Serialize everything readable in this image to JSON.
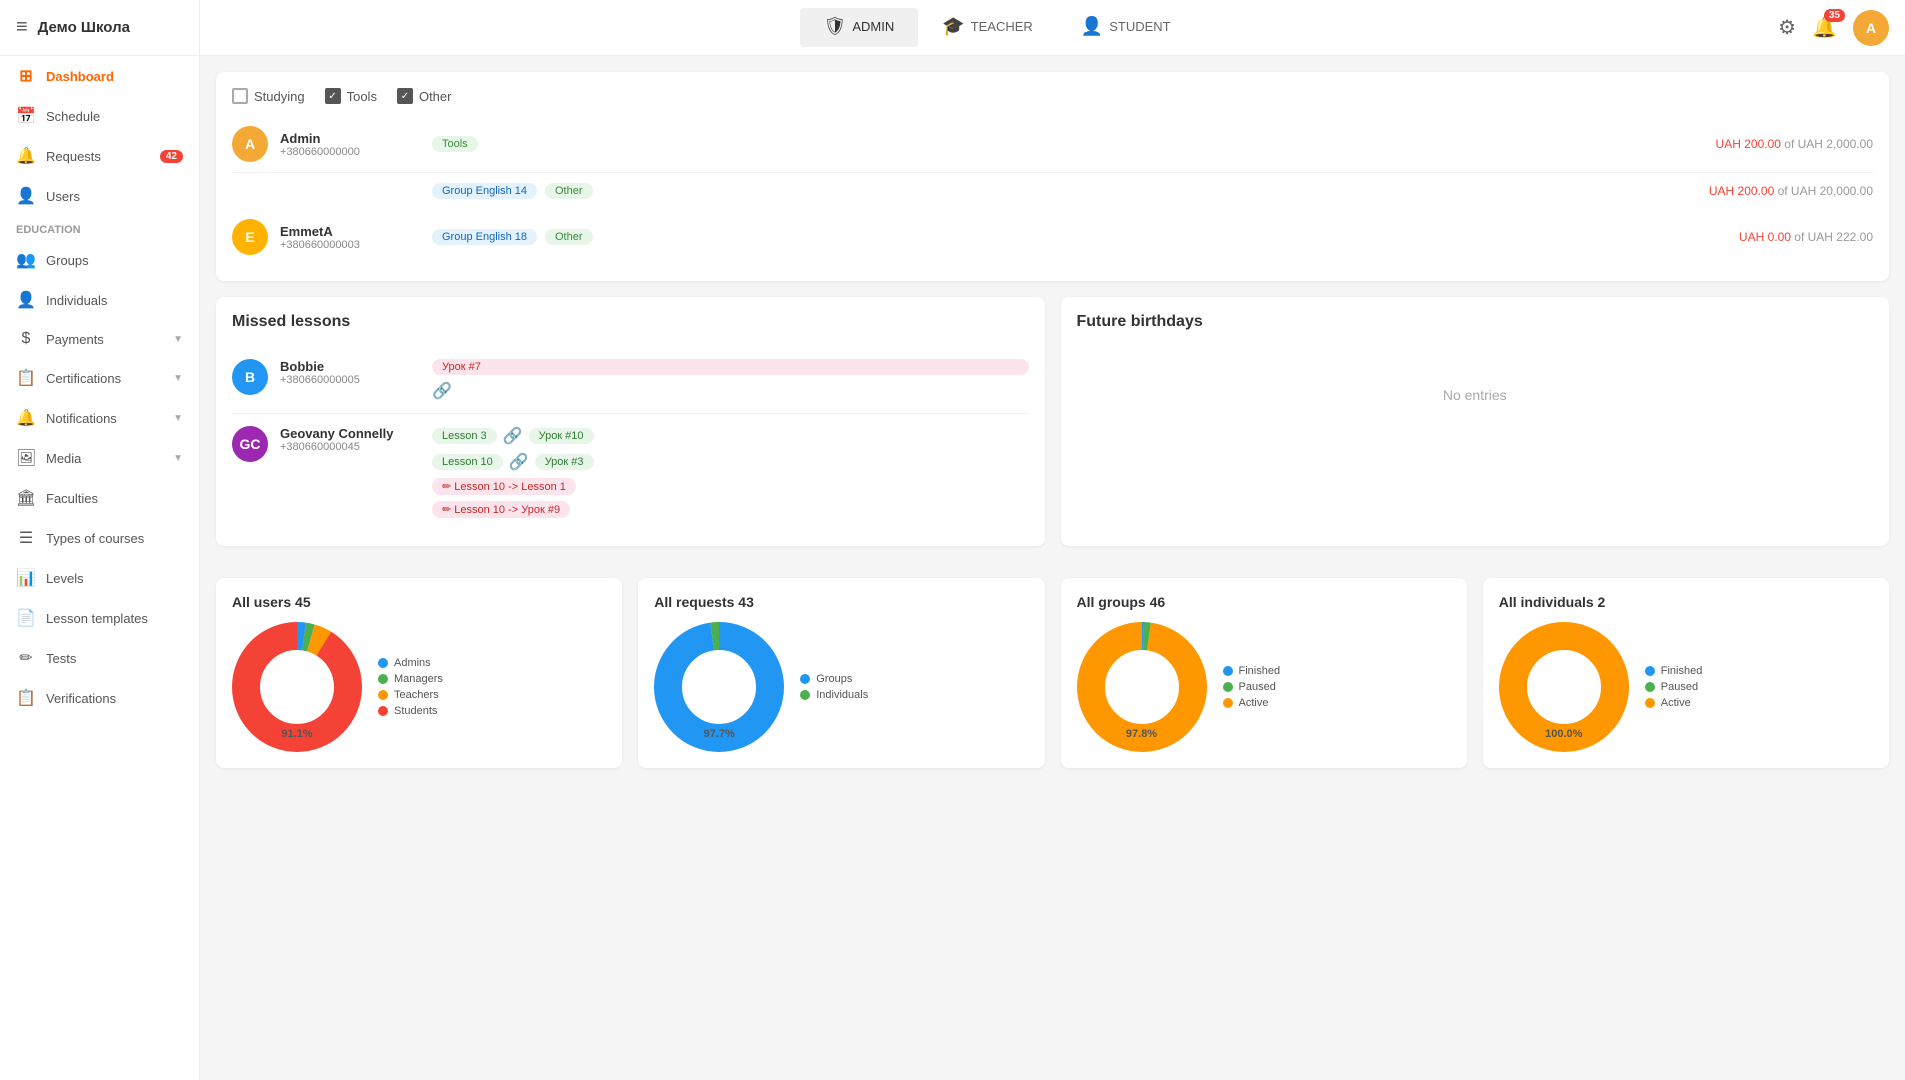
{
  "school": {
    "name": "Демо Школа"
  },
  "topbar": {
    "menu_icon": "≡",
    "tabs": [
      {
        "id": "admin",
        "label": "ADMIN",
        "icon": "🛡",
        "active": true
      },
      {
        "id": "teacher",
        "label": "TEACHER",
        "icon": "🎓",
        "active": false
      },
      {
        "id": "student",
        "label": "STUDENT",
        "icon": "👤",
        "active": false
      }
    ],
    "notif_count": "35",
    "avatar_letter": "A"
  },
  "sidebar": {
    "items": [
      {
        "id": "dashboard",
        "label": "Dashboard",
        "icon": "⊞",
        "active": true
      },
      {
        "id": "schedule",
        "label": "Schedule",
        "icon": "📅",
        "active": false
      },
      {
        "id": "requests",
        "label": "Requests",
        "icon": "🔔",
        "badge": "42",
        "active": false
      },
      {
        "id": "users",
        "label": "Users",
        "icon": "👤",
        "active": false
      },
      {
        "id": "groups",
        "label": "Groups",
        "icon": "👥",
        "active": false
      },
      {
        "id": "individuals",
        "label": "Individuals",
        "icon": "👤",
        "active": false
      },
      {
        "id": "payments",
        "label": "Payments",
        "icon": "$",
        "active": false,
        "arrow": true
      },
      {
        "id": "certifications",
        "label": "Certifications",
        "icon": "📋",
        "active": false,
        "arrow": true
      },
      {
        "id": "notifications",
        "label": "Notifications",
        "icon": "🔔",
        "active": false,
        "arrow": true
      },
      {
        "id": "media",
        "label": "Media",
        "icon": "🖼",
        "active": false,
        "arrow": true
      },
      {
        "id": "faculties",
        "label": "Faculties",
        "icon": "🏛",
        "active": false
      },
      {
        "id": "types-of-courses",
        "label": "Types of courses",
        "icon": "☰",
        "active": false
      },
      {
        "id": "levels",
        "label": "Levels",
        "icon": "📊",
        "active": false
      },
      {
        "id": "lesson-templates",
        "label": "Lesson templates",
        "icon": "📄",
        "active": false
      },
      {
        "id": "tests",
        "label": "Tests",
        "icon": "✏",
        "active": false
      },
      {
        "id": "verifications",
        "label": "Verifications",
        "icon": "📋",
        "active": false
      }
    ],
    "education_section": "Education"
  },
  "filters": [
    {
      "id": "studying",
      "label": "Studying",
      "checked": false
    },
    {
      "id": "tools",
      "label": "Tools",
      "checked": true
    },
    {
      "id": "other",
      "label": "Other",
      "checked": true
    }
  ],
  "users": [
    {
      "id": "admin",
      "name": "Admin",
      "phone": "+380660000000",
      "avatar_letter": "A",
      "avatar_color": "#f4a835",
      "rows": [
        {
          "group": null,
          "tag_label": "Tools",
          "tag_class": "tag-green",
          "amount_paid": "UAH 200.00",
          "amount_total": "UAH 2,000.00"
        },
        {
          "group": "Group English 14",
          "tag_label": "Other",
          "tag_class": "tag-green",
          "amount_paid": "UAH 200.00",
          "amount_total": "UAH 20,000.00"
        }
      ]
    },
    {
      "id": "emmeta",
      "name": "EmmetA",
      "phone": "+380660000003",
      "avatar_letter": "E",
      "avatar_color": "#ffb300",
      "rows": [
        {
          "group": "Group English 18",
          "tag_label": "Other",
          "tag_class": "tag-green",
          "amount_paid": "UAH 0.00",
          "amount_total": "UAH 222.00"
        }
      ]
    }
  ],
  "missed_lessons": {
    "title": "Missed lessons",
    "students": [
      {
        "id": "bobbie",
        "name": "Bobbie",
        "phone": "+380660000005",
        "avatar_letter": "B",
        "avatar_color": "#2196f3",
        "lessons": [
          {
            "label": "Урок #7",
            "type": "pink"
          }
        ]
      },
      {
        "id": "geovany",
        "name": "Geovany Connelly",
        "phone": "+380660000045",
        "avatar_letter": "GC",
        "avatar_color": "#9c27b0",
        "lessons": [
          {
            "label": "Lesson 3",
            "type": "green"
          },
          {
            "label": "Урок #10",
            "type": "green"
          },
          {
            "label": "Lesson 10",
            "type": "green"
          },
          {
            "label": "Урок #3",
            "type": "green"
          },
          {
            "label": "✏ Lesson 10 -> Lesson 1",
            "type": "pink"
          },
          {
            "label": "✏ Lesson 10 -> Урок #9",
            "type": "pink"
          }
        ]
      }
    ]
  },
  "future_birthdays": {
    "title": "Future birthdays",
    "no_entries": "No entries"
  },
  "stats": [
    {
      "id": "all-users",
      "title": "All users 45",
      "center_label": "91.1%",
      "segments": [
        {
          "label": "Admins",
          "color": "#2196f3",
          "percent": 2.2
        },
        {
          "label": "Managers",
          "color": "#4caf50",
          "percent": 2.2
        },
        {
          "label": "Teachers",
          "color": "#ff9800",
          "percent": 4.4
        },
        {
          "label": "Students",
          "color": "#f44336",
          "percent": 91.1
        }
      ]
    },
    {
      "id": "all-requests",
      "title": "All requests 43",
      "center_label": "97.7%",
      "segments": [
        {
          "label": "Groups",
          "color": "#2196f3",
          "percent": 97.7
        },
        {
          "label": "Individuals",
          "color": "#4caf50",
          "percent": 2.3
        }
      ]
    },
    {
      "id": "all-groups",
      "title": "All groups 46",
      "center_label": "97.8%",
      "segments": [
        {
          "label": "Finished",
          "color": "#2196f3",
          "percent": 0.5
        },
        {
          "label": "Paused",
          "color": "#4caf50",
          "percent": 1.7
        },
        {
          "label": "Active",
          "color": "#ff9800",
          "percent": 97.8
        }
      ]
    },
    {
      "id": "all-individuals",
      "title": "All individuals 2",
      "center_label": "100.0%",
      "segments": [
        {
          "label": "Finished",
          "color": "#2196f3",
          "percent": 0
        },
        {
          "label": "Paused",
          "color": "#4caf50",
          "percent": 0
        },
        {
          "label": "Active",
          "color": "#ff9800",
          "percent": 100
        }
      ]
    }
  ]
}
